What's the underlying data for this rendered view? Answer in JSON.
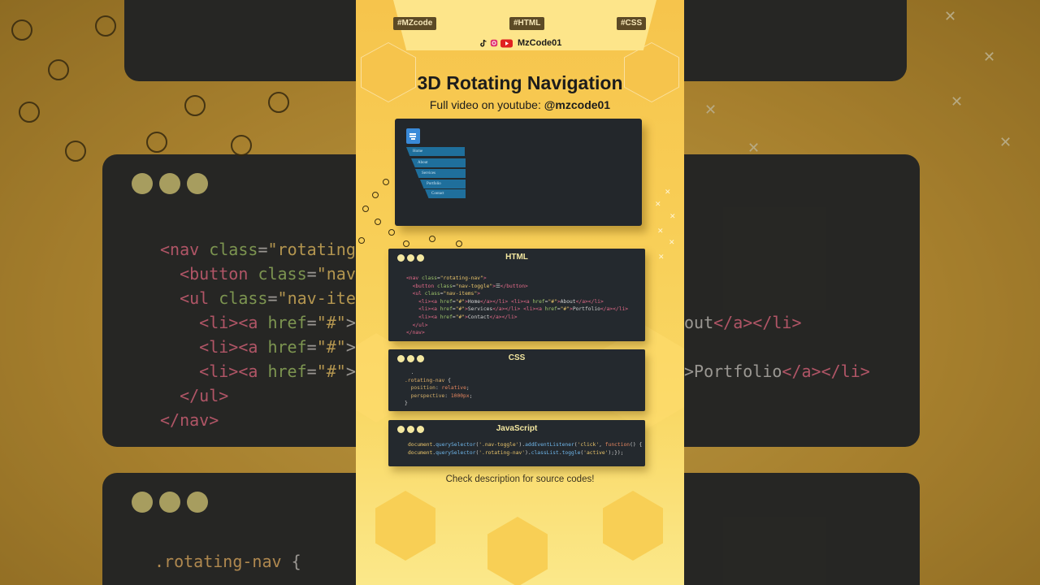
{
  "header": {
    "tags": [
      "#MZcode",
      "#HTML",
      "#CSS"
    ],
    "channel": "MzCode01"
  },
  "title": "3D Rotating Navigation",
  "subtitle_prefix": "Full video on youtube: ",
  "subtitle_handle": "@mzcode01",
  "demo": {
    "menu_icon": "menu-icon",
    "nav_items": [
      "Home",
      "About",
      "Services",
      "Portfolio",
      "Contact"
    ]
  },
  "cards": {
    "html_title": "HTML",
    "css_title": "CSS",
    "js_title": "JavaScript"
  },
  "note": "Check description for source codes!",
  "colors": {
    "accent_yellow": "#f8cd55",
    "code_bg": "#24292e",
    "nav_blue": "#1f6f9c",
    "button_blue": "#3a8ad8"
  },
  "icons": [
    "tiktok-icon",
    "instagram-icon",
    "youtube-icon",
    "menu-icon"
  ]
}
